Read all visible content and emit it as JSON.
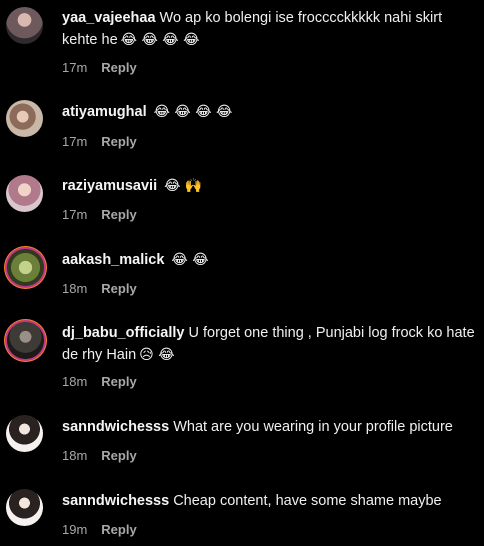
{
  "comments": [
    {
      "username": "yaa_vajeehaa",
      "text": "Wo ap ko bolengi ise frocccckkkkk nahi skirt kehte he",
      "emojis": "😂 😂 😂 😂",
      "time": "17m",
      "reply": "Reply"
    },
    {
      "username": "atiyamughal",
      "text": "",
      "emojis": "😂 😂 😂 😂",
      "time": "17m",
      "reply": "Reply"
    },
    {
      "username": "raziyamusavii",
      "text": "",
      "emojis": "😂 🙌",
      "time": "17m",
      "reply": "Reply"
    },
    {
      "username": "aakash_malick",
      "text": "",
      "emojis": "😂 😂",
      "time": "18m",
      "reply": "Reply"
    },
    {
      "username": "dj_babu_officially",
      "text": "U forget one thing , Punjabi log frock ko hate de rhy Hain",
      "emojis": "😥 😂",
      "time": "18m",
      "reply": "Reply"
    },
    {
      "username": "sanndwichesss",
      "text": "What are you wearing in your profile picture",
      "emojis": "",
      "time": "18m",
      "reply": "Reply"
    },
    {
      "username": "sanndwichesss",
      "text": "Cheap content, have some shame maybe",
      "emojis": "",
      "time": "19m",
      "reply": "Reply"
    }
  ]
}
